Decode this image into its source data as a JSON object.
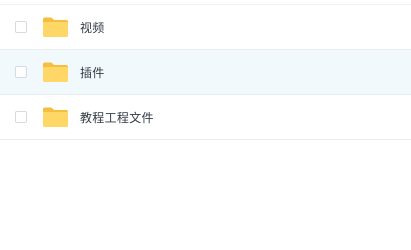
{
  "file_list": {
    "items": [
      {
        "name": "视频",
        "icon": "folder-icon",
        "selected": false,
        "highlighted": false
      },
      {
        "name": "插件",
        "icon": "folder-icon",
        "selected": false,
        "highlighted": true
      },
      {
        "name": "教程工程文件",
        "icon": "folder-icon",
        "selected": false,
        "highlighted": false
      }
    ],
    "colors": {
      "folder": "#FFD766",
      "folder_tab": "#F5BE3F",
      "row_highlight": "#F2F9FD",
      "text": "#333A44"
    }
  }
}
